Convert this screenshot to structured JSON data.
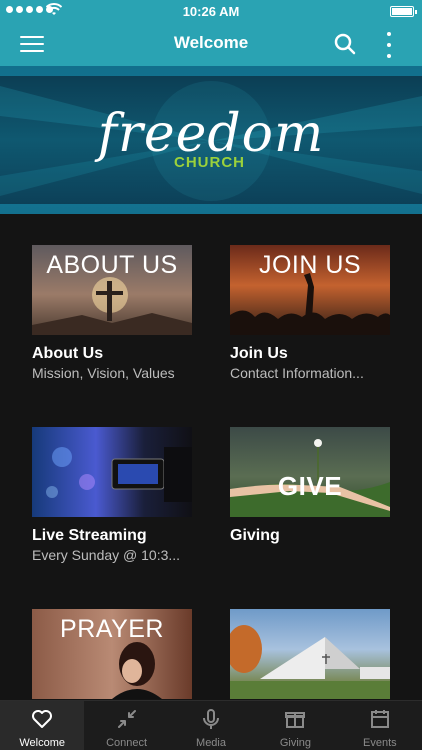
{
  "status_bar": {
    "time": "10:26 AM"
  },
  "app_bar": {
    "title": "Welcome"
  },
  "banner": {
    "title": "freedom",
    "subtitle": "CHURCH"
  },
  "tiles": [
    {
      "overlay": "ABOUT US",
      "label": "About Us",
      "sub": "Mission, Vision, Values"
    },
    {
      "overlay": "JOIN US",
      "label": "Join Us",
      "sub": "Contact Information..."
    },
    {
      "overlay": "",
      "label": "Live Streaming",
      "sub": "Every Sunday @ 10:3..."
    },
    {
      "overlay": "GIVE",
      "label": "Giving",
      "sub": ""
    },
    {
      "overlay": "PRAYER",
      "label": "",
      "sub": ""
    },
    {
      "overlay": "",
      "label": "",
      "sub": ""
    }
  ],
  "bottom_nav": [
    {
      "label": "Welcome",
      "icon": "heart-icon",
      "active": true
    },
    {
      "label": "Connect",
      "icon": "connect-icon",
      "active": false
    },
    {
      "label": "Media",
      "icon": "microphone-icon",
      "active": false
    },
    {
      "label": "Giving",
      "icon": "gift-icon",
      "active": false
    },
    {
      "label": "Events",
      "icon": "calendar-icon",
      "active": false
    }
  ],
  "colors": {
    "accent": "#2aa3b3",
    "background": "#141414",
    "brand_green": "#9bd13b"
  }
}
